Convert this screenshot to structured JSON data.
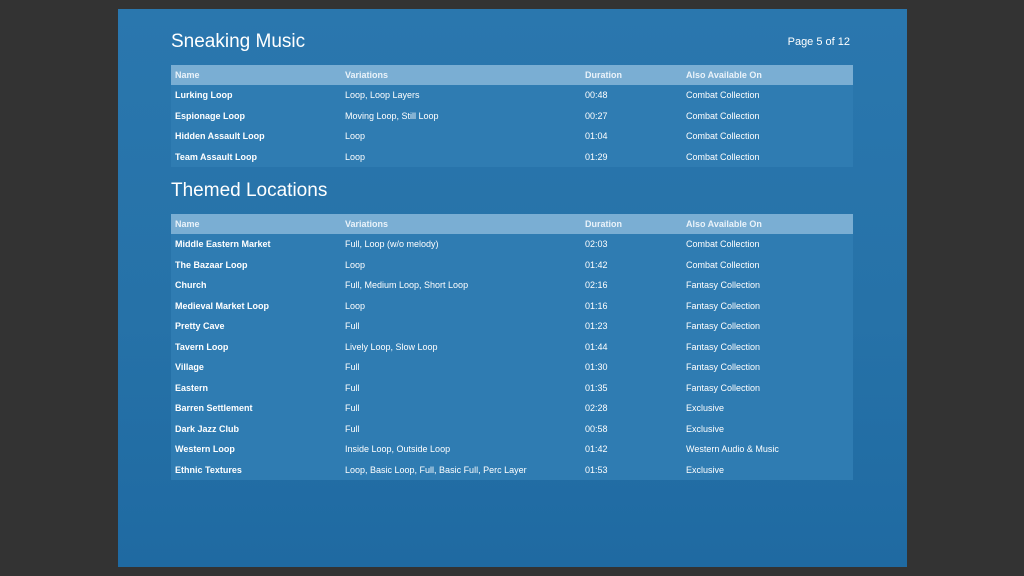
{
  "page_label": "Page 5 of 12",
  "columns": {
    "name": "Name",
    "variations": "Variations",
    "duration": "Duration",
    "also": "Also Available On"
  },
  "sections": [
    {
      "title": "Sneaking Music",
      "rows": [
        {
          "name": "Lurking Loop",
          "variations": "Loop, Loop Layers",
          "duration": "00:48",
          "also": "Combat Collection"
        },
        {
          "name": "Espionage Loop",
          "variations": "Moving Loop, Still Loop",
          "duration": "00:27",
          "also": "Combat Collection"
        },
        {
          "name": "Hidden Assault Loop",
          "variations": "Loop",
          "duration": "01:04",
          "also": "Combat Collection"
        },
        {
          "name": "Team Assault Loop",
          "variations": "Loop",
          "duration": "01:29",
          "also": "Combat Collection"
        }
      ]
    },
    {
      "title": "Themed Locations",
      "rows": [
        {
          "name": "Middle Eastern Market",
          "variations": "Full, Loop (w/o melody)",
          "duration": "02:03",
          "also": "Combat Collection"
        },
        {
          "name": "The Bazaar Loop",
          "variations": "Loop",
          "duration": "01:42",
          "also": "Combat Collection"
        },
        {
          "name": "Church",
          "variations": "Full, Medium Loop, Short Loop",
          "duration": "02:16",
          "also": "Fantasy Collection"
        },
        {
          "name": "Medieval Market Loop",
          "variations": "Loop",
          "duration": "01:16",
          "also": "Fantasy Collection"
        },
        {
          "name": "Pretty Cave",
          "variations": "Full",
          "duration": "01:23",
          "also": "Fantasy Collection"
        },
        {
          "name": "Tavern Loop",
          "variations": "Lively Loop, Slow Loop",
          "duration": "01:44",
          "also": "Fantasy Collection"
        },
        {
          "name": "Village",
          "variations": "Full",
          "duration": "01:30",
          "also": "Fantasy Collection"
        },
        {
          "name": "Eastern",
          "variations": "Full",
          "duration": "01:35",
          "also": "Fantasy Collection"
        },
        {
          "name": "Barren Settlement",
          "variations": "Full",
          "duration": "02:28",
          "also": "Exclusive"
        },
        {
          "name": "Dark Jazz Club",
          "variations": "Full",
          "duration": "00:58",
          "also": "Exclusive"
        },
        {
          "name": "Western Loop",
          "variations": "Inside Loop, Outside Loop",
          "duration": "01:42",
          "also": "Western Audio & Music"
        },
        {
          "name": "Ethnic Textures",
          "variations": "Loop, Basic Loop, Full, Basic Full, Perc Layer",
          "duration": "01:53",
          "also": "Exclusive"
        }
      ]
    }
  ]
}
